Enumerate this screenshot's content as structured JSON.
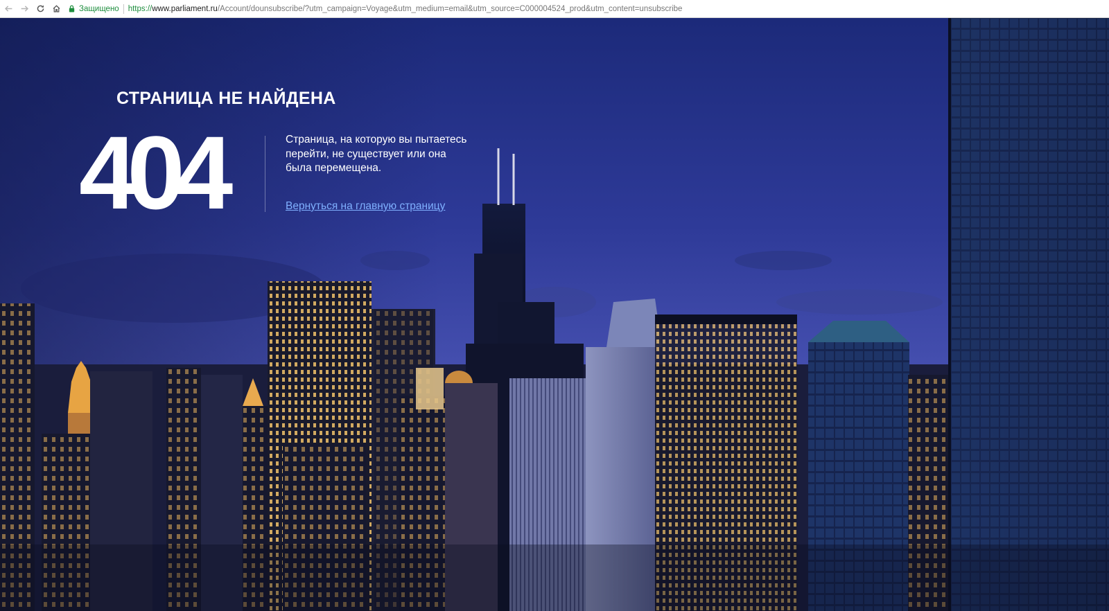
{
  "browser": {
    "security_label": "Защищено",
    "url": {
      "scheme": "https://",
      "host": "www.parliament.ru",
      "path": "/Account/dounsubscribe/?utm_campaign=Voyage&utm_medium=email&utm_source=C000004524_prod&utm_content=unsubscribe"
    },
    "icons": [
      "back-arrow-icon",
      "forward-arrow-icon",
      "reload-icon",
      "home-icon",
      "lock-icon"
    ]
  },
  "error_page": {
    "title": "СТРАНИЦА НЕ НАЙДЕНА",
    "code": "404",
    "message": "Страница, на которую вы пытаетесь перейти, не существует или она была перемещена.",
    "home_link": "Вернуться на главную страницу"
  },
  "colors": {
    "sky_top": "#1c2a7a",
    "sky_mid": "#3a44a8",
    "link": "#7fb0ff",
    "secure_green": "#1e8e3e"
  }
}
